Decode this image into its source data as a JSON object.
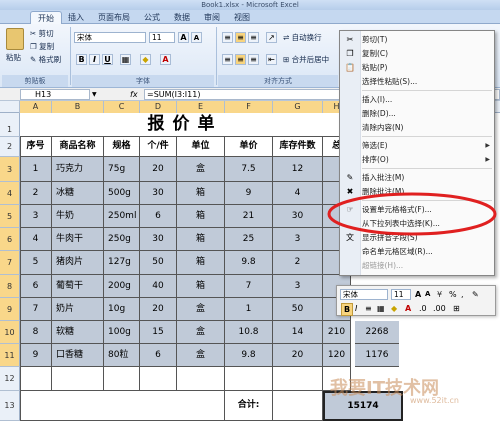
{
  "window": {
    "title": "Book1.xlsx - Microsoft Excel"
  },
  "tabs": [
    "开始",
    "插入",
    "页面布局",
    "公式",
    "数据",
    "审阅",
    "视图"
  ],
  "ribbon": {
    "clipboard": {
      "cut": "剪切",
      "copy": "复制",
      "format_painter": "格式刷",
      "paste": "粘贴",
      "label": "剪贴板"
    },
    "font": {
      "name": "宋体",
      "size": "11",
      "bold": "B",
      "italic": "I",
      "underline": "U",
      "font_color": "A",
      "label": "字体"
    },
    "align": {
      "wrap": "自动换行",
      "merge": "合并后居中",
      "label": "对齐方式"
    }
  },
  "formula_bar": {
    "name_box": "H13",
    "fx": "fx",
    "formula": "=SUM(I3:I11)"
  },
  "columns": [
    "A",
    "B",
    "C",
    "D",
    "E",
    "F",
    "G",
    "H"
  ],
  "sheet": {
    "title": "报价单",
    "headers": [
      "序号",
      "商品名称",
      "规格",
      "个/件",
      "单位",
      "单价",
      "库存件数",
      "总"
    ],
    "rows": [
      {
        "no": "1",
        "name": "巧克力",
        "spec": "75g",
        "per": "20",
        "unit": "盒",
        "price": "7.5",
        "stock": "12",
        "total": ""
      },
      {
        "no": "2",
        "name": "冰糖",
        "spec": "500g",
        "per": "30",
        "unit": "箱",
        "price": "9",
        "stock": "4",
        "total": ""
      },
      {
        "no": "3",
        "name": "牛奶",
        "spec": "250ml",
        "per": "6",
        "unit": "箱",
        "price": "21",
        "stock": "30",
        "total": ""
      },
      {
        "no": "4",
        "name": "牛肉干",
        "spec": "250g",
        "per": "30",
        "unit": "箱",
        "price": "25",
        "stock": "3",
        "total": ""
      },
      {
        "no": "5",
        "name": "猪肉片",
        "spec": "127g",
        "per": "50",
        "unit": "箱",
        "price": "9.8",
        "stock": "2",
        "total": ""
      },
      {
        "no": "6",
        "name": "葡萄干",
        "spec": "200g",
        "per": "40",
        "unit": "箱",
        "price": "7",
        "stock": "3",
        "total": ""
      },
      {
        "no": "7",
        "name": "奶片",
        "spec": "10g",
        "per": "20",
        "unit": "盒",
        "price": "1",
        "stock": "50",
        "total": ""
      },
      {
        "no": "8",
        "name": "软糖",
        "spec": "100g",
        "per": "15",
        "unit": "盒",
        "price": "10.8",
        "stock": "14",
        "total": "210",
        "extra": "2268"
      },
      {
        "no": "9",
        "name": "口香糖",
        "spec": "80粒",
        "per": "6",
        "unit": "盒",
        "price": "9.8",
        "stock": "20",
        "total": "120",
        "extra": "1176"
      }
    ],
    "total_label": "合计:",
    "total_value": "15174"
  },
  "context_menu": {
    "items": [
      "剪切(T)",
      "复制(C)",
      "粘贴(P)",
      "选择性粘贴(S)...",
      "插入(I)...",
      "删除(D)...",
      "清除内容(N)",
      "筛选(E)",
      "排序(O)",
      "插入批注(M)",
      "删除批注(M)",
      "设置单元格格式(F)...",
      "从下拉列表中选择(K)...",
      "显示拼音字段(S)",
      "命名单元格区域(R)...",
      "超链接(H)..."
    ]
  },
  "mini_toolbar": {
    "font": "宋体",
    "size": "11",
    "percent": "%",
    "comma": ","
  },
  "watermark": {
    "main": "我要IT技术网",
    "sub": "www.52it.cn"
  },
  "colors": {
    "selection": "#c0cad8",
    "highlight_oval": "#e02020",
    "header_selected": "#f9d78a"
  }
}
